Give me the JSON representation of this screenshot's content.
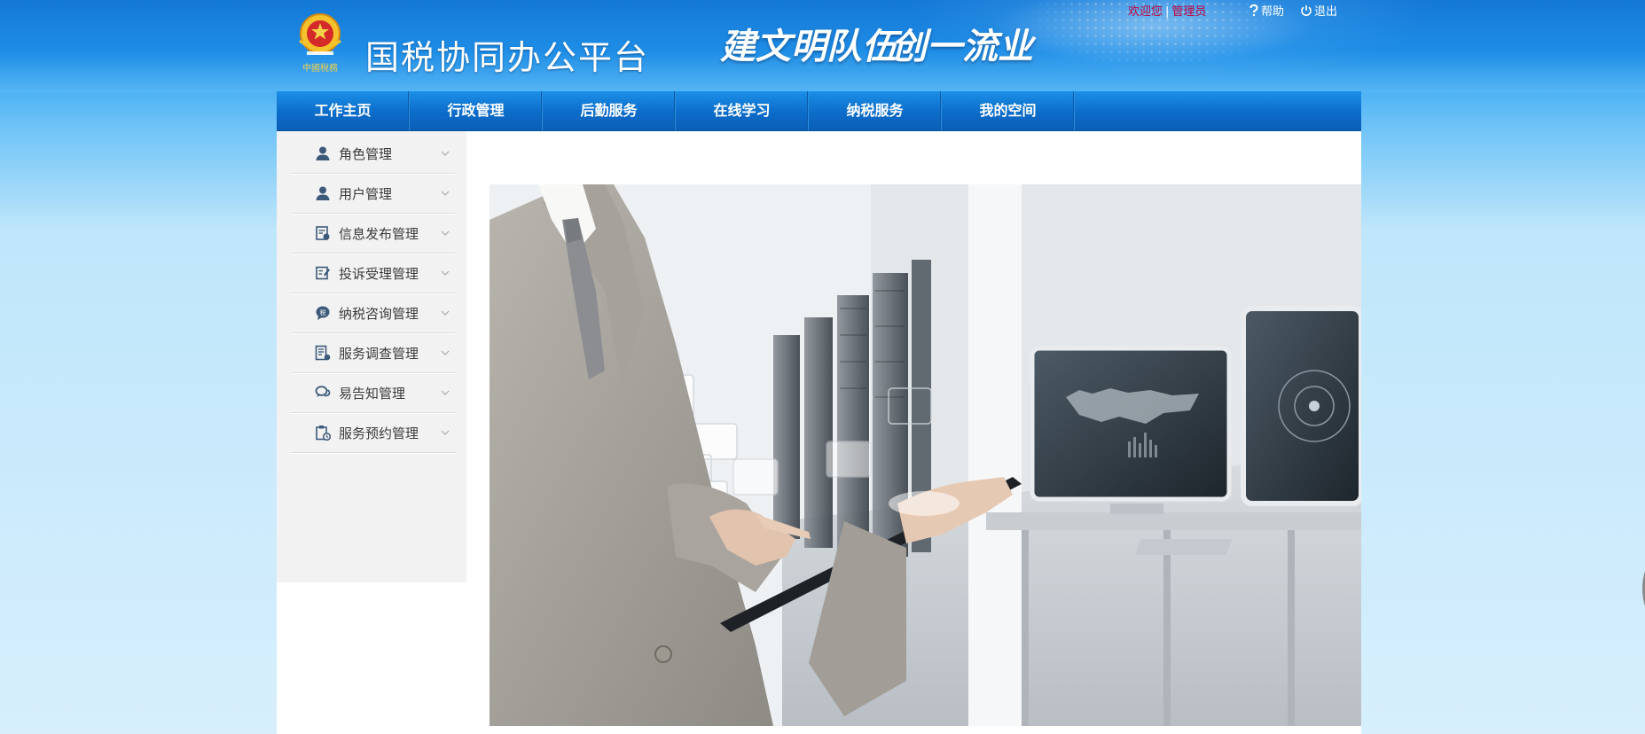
{
  "header": {
    "app_title": "国税协同办公平台",
    "emblem_caption": "中國稅務",
    "slogan_1": "建文明队伍",
    "slogan_2": "创一流业",
    "welcome_text": "欢迎您",
    "username": "管理员",
    "help_label": "帮助",
    "logout_label": "退出"
  },
  "nav": {
    "items": [
      {
        "label": "工作主页"
      },
      {
        "label": "行政管理"
      },
      {
        "label": "后勤服务"
      },
      {
        "label": "在线学习"
      },
      {
        "label": "纳税服务"
      },
      {
        "label": "我的空间"
      }
    ]
  },
  "sidebar": {
    "items": [
      {
        "label": "角色管理",
        "icon": "user-icon"
      },
      {
        "label": "用户管理",
        "icon": "user-icon"
      },
      {
        "label": "信息发布管理",
        "icon": "publish-icon"
      },
      {
        "label": "投诉受理管理",
        "icon": "edit-note-icon"
      },
      {
        "label": "纳税咨询管理",
        "icon": "tax-chat-icon"
      },
      {
        "label": "服务调查管理",
        "icon": "survey-icon"
      },
      {
        "label": "易告知管理",
        "icon": "chat-bubbles-icon"
      },
      {
        "label": "服务预约管理",
        "icon": "clipboard-clock-icon"
      }
    ]
  },
  "colors": {
    "banner_blue": "#1e8de6",
    "nav_blue": "#0c6cc9",
    "username_red": "#c0003c",
    "sidebar_bg": "#f2f2f2",
    "menu_text": "#3a3a3a"
  }
}
